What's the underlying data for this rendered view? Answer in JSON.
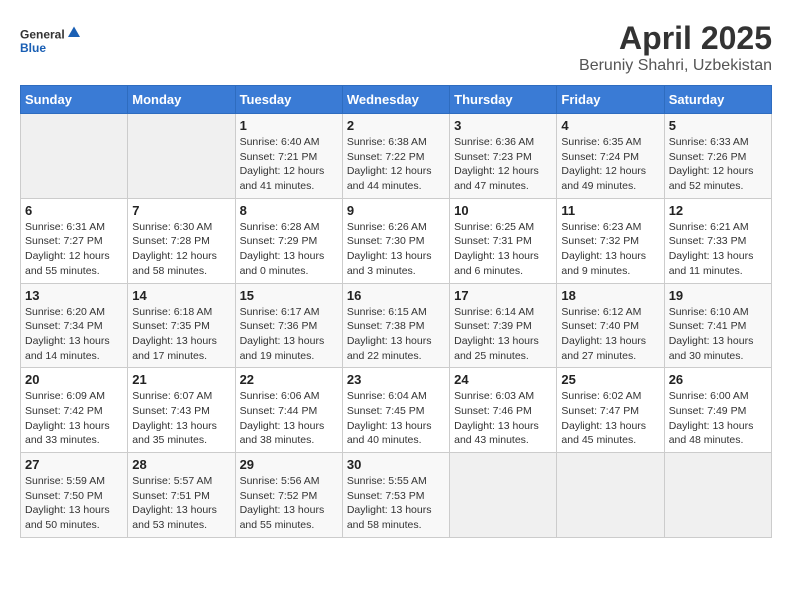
{
  "header": {
    "logo_line1": "General",
    "logo_line2": "Blue",
    "month_year": "April 2025",
    "location": "Beruniy Shahri, Uzbekistan"
  },
  "weekdays": [
    "Sunday",
    "Monday",
    "Tuesday",
    "Wednesday",
    "Thursday",
    "Friday",
    "Saturday"
  ],
  "weeks": [
    [
      {
        "num": "",
        "sunrise": "",
        "sunset": "",
        "daylight": ""
      },
      {
        "num": "",
        "sunrise": "",
        "sunset": "",
        "daylight": ""
      },
      {
        "num": "1",
        "sunrise": "Sunrise: 6:40 AM",
        "sunset": "Sunset: 7:21 PM",
        "daylight": "Daylight: 12 hours and 41 minutes."
      },
      {
        "num": "2",
        "sunrise": "Sunrise: 6:38 AM",
        "sunset": "Sunset: 7:22 PM",
        "daylight": "Daylight: 12 hours and 44 minutes."
      },
      {
        "num": "3",
        "sunrise": "Sunrise: 6:36 AM",
        "sunset": "Sunset: 7:23 PM",
        "daylight": "Daylight: 12 hours and 47 minutes."
      },
      {
        "num": "4",
        "sunrise": "Sunrise: 6:35 AM",
        "sunset": "Sunset: 7:24 PM",
        "daylight": "Daylight: 12 hours and 49 minutes."
      },
      {
        "num": "5",
        "sunrise": "Sunrise: 6:33 AM",
        "sunset": "Sunset: 7:26 PM",
        "daylight": "Daylight: 12 hours and 52 minutes."
      }
    ],
    [
      {
        "num": "6",
        "sunrise": "Sunrise: 6:31 AM",
        "sunset": "Sunset: 7:27 PM",
        "daylight": "Daylight: 12 hours and 55 minutes."
      },
      {
        "num": "7",
        "sunrise": "Sunrise: 6:30 AM",
        "sunset": "Sunset: 7:28 PM",
        "daylight": "Daylight: 12 hours and 58 minutes."
      },
      {
        "num": "8",
        "sunrise": "Sunrise: 6:28 AM",
        "sunset": "Sunset: 7:29 PM",
        "daylight": "Daylight: 13 hours and 0 minutes."
      },
      {
        "num": "9",
        "sunrise": "Sunrise: 6:26 AM",
        "sunset": "Sunset: 7:30 PM",
        "daylight": "Daylight: 13 hours and 3 minutes."
      },
      {
        "num": "10",
        "sunrise": "Sunrise: 6:25 AM",
        "sunset": "Sunset: 7:31 PM",
        "daylight": "Daylight: 13 hours and 6 minutes."
      },
      {
        "num": "11",
        "sunrise": "Sunrise: 6:23 AM",
        "sunset": "Sunset: 7:32 PM",
        "daylight": "Daylight: 13 hours and 9 minutes."
      },
      {
        "num": "12",
        "sunrise": "Sunrise: 6:21 AM",
        "sunset": "Sunset: 7:33 PM",
        "daylight": "Daylight: 13 hours and 11 minutes."
      }
    ],
    [
      {
        "num": "13",
        "sunrise": "Sunrise: 6:20 AM",
        "sunset": "Sunset: 7:34 PM",
        "daylight": "Daylight: 13 hours and 14 minutes."
      },
      {
        "num": "14",
        "sunrise": "Sunrise: 6:18 AM",
        "sunset": "Sunset: 7:35 PM",
        "daylight": "Daylight: 13 hours and 17 minutes."
      },
      {
        "num": "15",
        "sunrise": "Sunrise: 6:17 AM",
        "sunset": "Sunset: 7:36 PM",
        "daylight": "Daylight: 13 hours and 19 minutes."
      },
      {
        "num": "16",
        "sunrise": "Sunrise: 6:15 AM",
        "sunset": "Sunset: 7:38 PM",
        "daylight": "Daylight: 13 hours and 22 minutes."
      },
      {
        "num": "17",
        "sunrise": "Sunrise: 6:14 AM",
        "sunset": "Sunset: 7:39 PM",
        "daylight": "Daylight: 13 hours and 25 minutes."
      },
      {
        "num": "18",
        "sunrise": "Sunrise: 6:12 AM",
        "sunset": "Sunset: 7:40 PM",
        "daylight": "Daylight: 13 hours and 27 minutes."
      },
      {
        "num": "19",
        "sunrise": "Sunrise: 6:10 AM",
        "sunset": "Sunset: 7:41 PM",
        "daylight": "Daylight: 13 hours and 30 minutes."
      }
    ],
    [
      {
        "num": "20",
        "sunrise": "Sunrise: 6:09 AM",
        "sunset": "Sunset: 7:42 PM",
        "daylight": "Daylight: 13 hours and 33 minutes."
      },
      {
        "num": "21",
        "sunrise": "Sunrise: 6:07 AM",
        "sunset": "Sunset: 7:43 PM",
        "daylight": "Daylight: 13 hours and 35 minutes."
      },
      {
        "num": "22",
        "sunrise": "Sunrise: 6:06 AM",
        "sunset": "Sunset: 7:44 PM",
        "daylight": "Daylight: 13 hours and 38 minutes."
      },
      {
        "num": "23",
        "sunrise": "Sunrise: 6:04 AM",
        "sunset": "Sunset: 7:45 PM",
        "daylight": "Daylight: 13 hours and 40 minutes."
      },
      {
        "num": "24",
        "sunrise": "Sunrise: 6:03 AM",
        "sunset": "Sunset: 7:46 PM",
        "daylight": "Daylight: 13 hours and 43 minutes."
      },
      {
        "num": "25",
        "sunrise": "Sunrise: 6:02 AM",
        "sunset": "Sunset: 7:47 PM",
        "daylight": "Daylight: 13 hours and 45 minutes."
      },
      {
        "num": "26",
        "sunrise": "Sunrise: 6:00 AM",
        "sunset": "Sunset: 7:49 PM",
        "daylight": "Daylight: 13 hours and 48 minutes."
      }
    ],
    [
      {
        "num": "27",
        "sunrise": "Sunrise: 5:59 AM",
        "sunset": "Sunset: 7:50 PM",
        "daylight": "Daylight: 13 hours and 50 minutes."
      },
      {
        "num": "28",
        "sunrise": "Sunrise: 5:57 AM",
        "sunset": "Sunset: 7:51 PM",
        "daylight": "Daylight: 13 hours and 53 minutes."
      },
      {
        "num": "29",
        "sunrise": "Sunrise: 5:56 AM",
        "sunset": "Sunset: 7:52 PM",
        "daylight": "Daylight: 13 hours and 55 minutes."
      },
      {
        "num": "30",
        "sunrise": "Sunrise: 5:55 AM",
        "sunset": "Sunset: 7:53 PM",
        "daylight": "Daylight: 13 hours and 58 minutes."
      },
      {
        "num": "",
        "sunrise": "",
        "sunset": "",
        "daylight": ""
      },
      {
        "num": "",
        "sunrise": "",
        "sunset": "",
        "daylight": ""
      },
      {
        "num": "",
        "sunrise": "",
        "sunset": "",
        "daylight": ""
      }
    ]
  ]
}
